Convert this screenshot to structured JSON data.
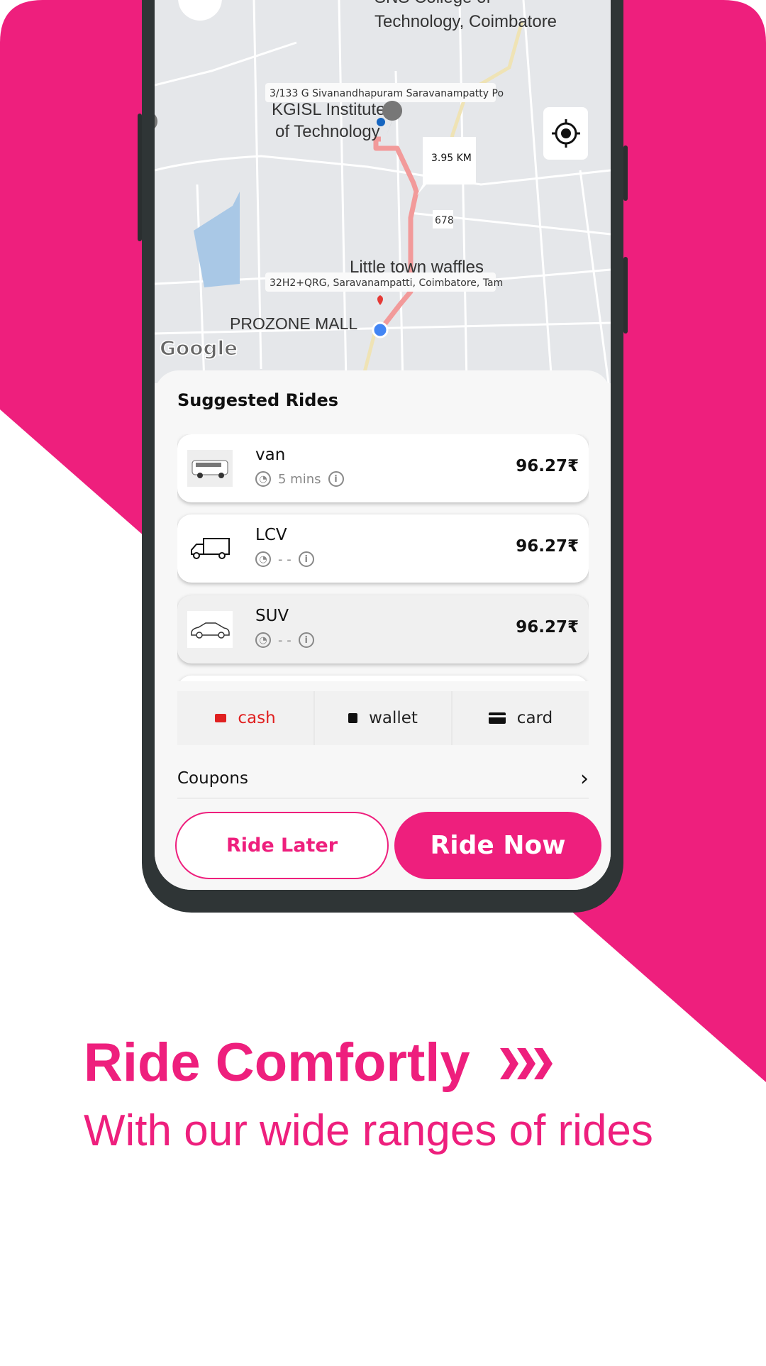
{
  "colors": {
    "brand": "#ee1f7d",
    "frame": "#2f3536",
    "map_bg": "#e5e7ea",
    "route": "#f29a9a",
    "cash": "#e02020"
  },
  "map": {
    "poi_top_line1": "SNS College of",
    "poi_top_line2": "Technology, Coimbatore",
    "pickup_address": "3/133 G Sivanandhapuram Saravanampatty Po",
    "poi_kgisl_line1": "KGISL Institute",
    "poi_kgisl_line2": "of Technology",
    "distance": "3.95 KM",
    "road_number": "678",
    "poi_waffles": "Little town waffles",
    "drop_address": "32H2+QRG, Saravanampatti, Coimbatore, Tam",
    "poi_mall": "PROZONE MALL",
    "attribution": "Google"
  },
  "sheet": {
    "title": "Suggested Rides",
    "rides": [
      {
        "name": "van",
        "eta": "5 mins",
        "price": "96.27₹",
        "icon": "van-icon"
      },
      {
        "name": "LCV",
        "eta": "- -",
        "price": "96.27₹",
        "icon": "truck-icon"
      },
      {
        "name": "SUV",
        "eta": "- -",
        "price": "96.27₹",
        "icon": "car-icon",
        "selected": true
      }
    ],
    "payment": [
      {
        "label": "cash",
        "icon": "cash-icon",
        "selected": true
      },
      {
        "label": "wallet",
        "icon": "wallet-icon"
      },
      {
        "label": "card",
        "icon": "card-icon"
      }
    ],
    "coupons": "Coupons",
    "ride_later": "Ride Later",
    "ride_now": "Ride Now"
  },
  "promo": {
    "headline": "Ride Comfortly",
    "subline": "With our wide ranges of rides"
  }
}
